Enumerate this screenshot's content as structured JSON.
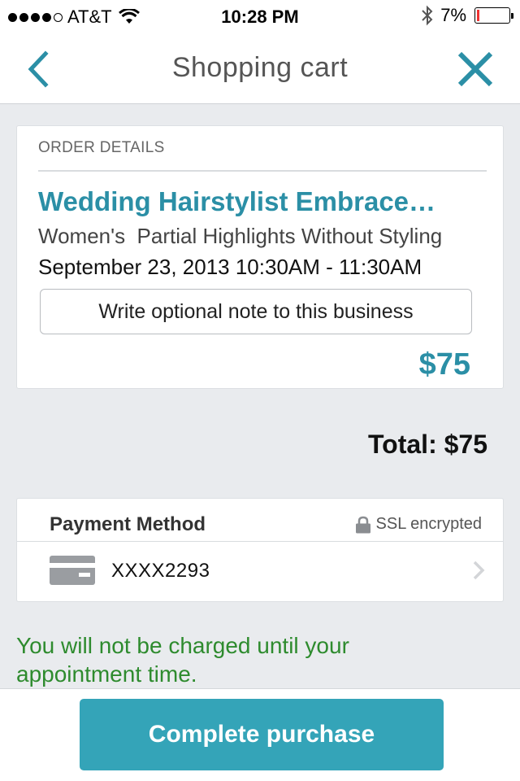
{
  "status_bar": {
    "carrier": "AT&T",
    "time": "10:28 PM",
    "battery_percent": "7%",
    "battery_level": 0.07,
    "signal_bars_filled": 4,
    "signal_bars_total": 5,
    "icons": [
      "wifi-icon",
      "bluetooth-icon",
      "battery-icon"
    ]
  },
  "nav": {
    "title": "Shopping cart",
    "back_icon": "chevron-left-icon",
    "close_icon": "close-icon"
  },
  "order": {
    "section_label": "ORDER DETAILS",
    "business_name": "Wedding Hairstylist Embrace…",
    "service": "Women's  Partial Highlights Without Styling",
    "datetime": "September 23, 2013 10:30AM - 11:30AM",
    "note_button": "Write optional note to this business",
    "price": "$75"
  },
  "total": "Total: $75",
  "payment": {
    "title": "Payment Method",
    "ssl_label": "SSL encrypted",
    "card_number": "XXXX2293",
    "icons": [
      "lock-icon",
      "credit-card-icon",
      "chevron-right-icon"
    ]
  },
  "notice": "You will not be charged until your appointment time.",
  "complete_button": "Complete purchase",
  "colors": {
    "accent": "#2b8fa6",
    "button": "#34a4b8",
    "notice": "#2e8b2e",
    "background": "#e9ebee"
  }
}
